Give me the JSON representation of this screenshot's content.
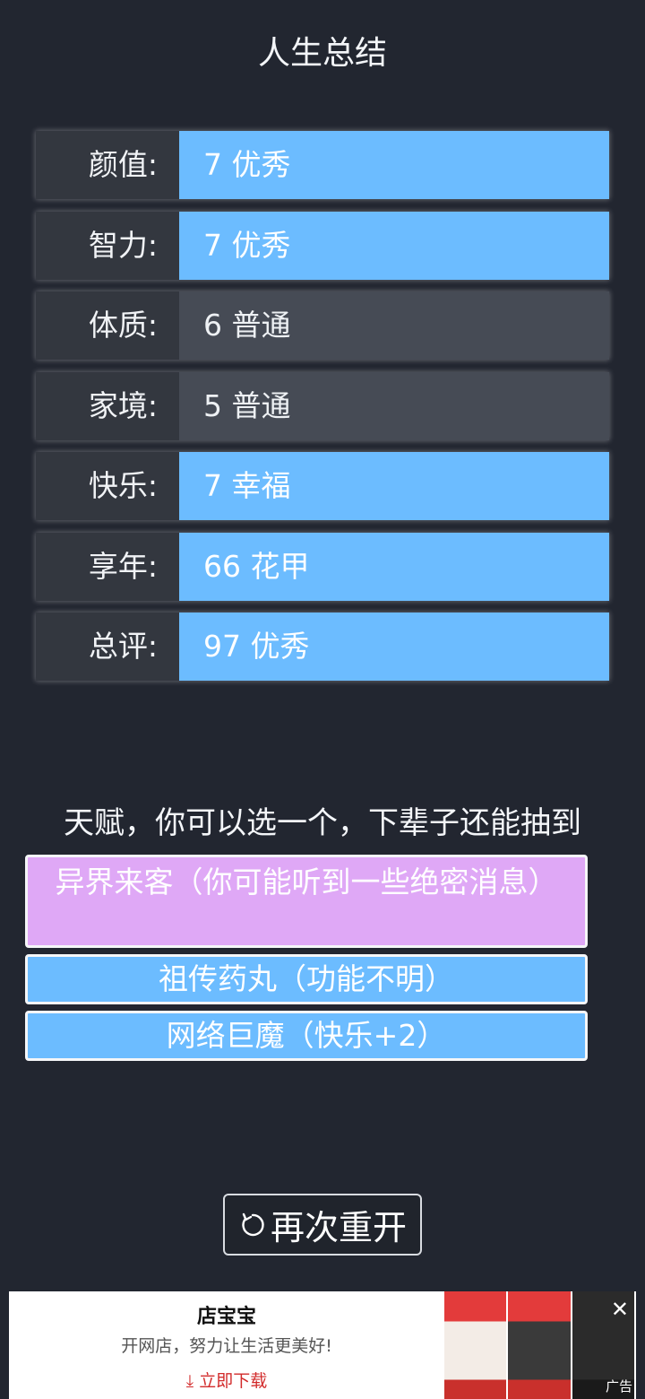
{
  "title": "人生总结",
  "stats": [
    {
      "label": "颜值:",
      "value": "7 优秀",
      "level": "good"
    },
    {
      "label": "智力:",
      "value": "7 优秀",
      "level": "good"
    },
    {
      "label": "体质:",
      "value": "6 普通",
      "level": "normal"
    },
    {
      "label": "家境:",
      "value": "5 普通",
      "level": "normal"
    },
    {
      "label": "快乐:",
      "value": "7 幸福",
      "level": "good"
    },
    {
      "label": "享年:",
      "value": "66 花甲",
      "level": "good"
    },
    {
      "label": "总评:",
      "value": "97 优秀",
      "level": "good"
    }
  ],
  "talent_heading": "天赋，你可以选一个，下辈子还能抽到",
  "talents": [
    {
      "text": "异界来客（你可能听到一些绝密消息）",
      "color": "#dfa8f6"
    },
    {
      "text": "祖传药丸（功能不明）",
      "color": "#6cbcff"
    },
    {
      "text": "网络巨魔（快乐+2）",
      "color": "#6cbcff"
    }
  ],
  "restart_label": "再次重开",
  "restart_icon": "refresh-icon",
  "ad": {
    "brand": "店宝宝",
    "slogan": "开网店，努力让生活更美好!",
    "download": "立即下载",
    "tag": "广告",
    "close_icon": "close-icon"
  },
  "colors": {
    "background": "#222630",
    "good": "#6cbcff",
    "normal": "#464b55",
    "talent_special": "#dfa8f6"
  }
}
